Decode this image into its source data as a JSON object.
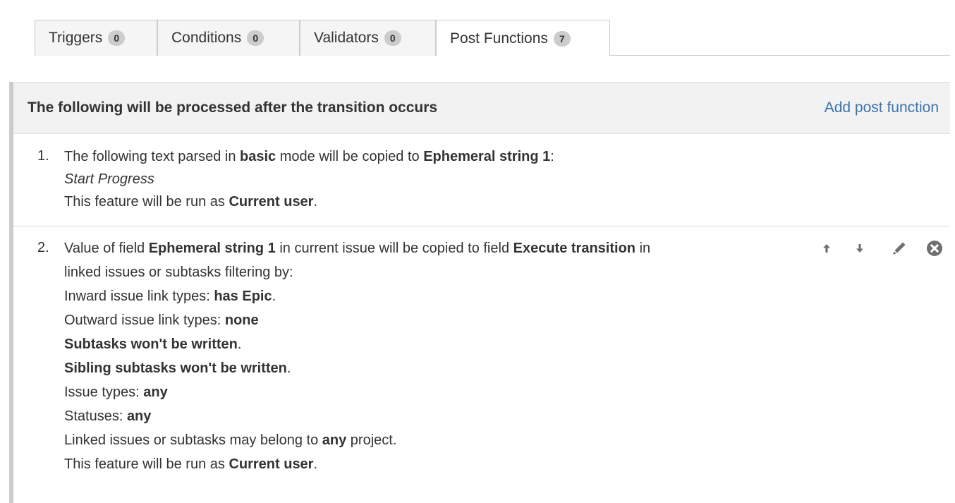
{
  "tabs": [
    {
      "label": "Triggers",
      "count": "0"
    },
    {
      "label": "Conditions",
      "count": "0"
    },
    {
      "label": "Validators",
      "count": "0"
    },
    {
      "label": "Post Functions",
      "count": "7"
    }
  ],
  "panel": {
    "title": "The following will be processed after the transition occurs",
    "add_link": "Add post function"
  },
  "items": [
    {
      "number": "1.",
      "lines": [
        {
          "segments": [
            {
              "text": "The following text parsed in ",
              "style": "normal"
            },
            {
              "text": "basic",
              "style": "bold"
            },
            {
              "text": " mode will be copied to ",
              "style": "normal"
            },
            {
              "text": "Ephemeral string 1",
              "style": "bold"
            },
            {
              "text": ":",
              "style": "normal"
            }
          ]
        },
        {
          "segments": [
            {
              "text": "Start Progress",
              "style": "italic"
            }
          ]
        },
        {
          "segments": [
            {
              "text": "This feature will be run as ",
              "style": "normal"
            },
            {
              "text": "Current user",
              "style": "bold"
            },
            {
              "text": ".",
              "style": "normal"
            }
          ]
        }
      ]
    },
    {
      "number": "2.",
      "lines": [
        {
          "segments": [
            {
              "text": "Value of field ",
              "style": "normal"
            },
            {
              "text": "Ephemeral string 1",
              "style": "bold"
            },
            {
              "text": " in current issue will be copied to field ",
              "style": "normal"
            },
            {
              "text": "Execute transition",
              "style": "bold"
            },
            {
              "text": " in",
              "style": "normal"
            }
          ]
        },
        {
          "segments": [
            {
              "text": "linked issues or subtasks filtering by:",
              "style": "normal"
            }
          ]
        },
        {
          "segments": [
            {
              "text": "Inward issue link types: ",
              "style": "normal"
            },
            {
              "text": "has Epic",
              "style": "bold"
            },
            {
              "text": ".",
              "style": "normal"
            }
          ]
        },
        {
          "segments": [
            {
              "text": "Outward issue link types: ",
              "style": "normal"
            },
            {
              "text": "none",
              "style": "bold"
            }
          ]
        },
        {
          "segments": [
            {
              "text": "Subtasks won't be written",
              "style": "bold"
            },
            {
              "text": ".",
              "style": "normal"
            }
          ]
        },
        {
          "segments": [
            {
              "text": "Sibling subtasks won't be written",
              "style": "bold"
            },
            {
              "text": ".",
              "style": "normal"
            }
          ]
        },
        {
          "segments": [
            {
              "text": "Issue types: ",
              "style": "normal"
            },
            {
              "text": "any",
              "style": "bold"
            }
          ]
        },
        {
          "segments": [
            {
              "text": "Statuses: ",
              "style": "normal"
            },
            {
              "text": "any",
              "style": "bold"
            }
          ]
        },
        {
          "segments": [
            {
              "text": "Linked issues or subtasks may belong to ",
              "style": "normal"
            },
            {
              "text": "any",
              "style": "bold"
            },
            {
              "text": " project.",
              "style": "normal"
            }
          ]
        },
        {
          "segments": [
            {
              "text": "This feature will be run as ",
              "style": "normal"
            },
            {
              "text": "Current user",
              "style": "bold"
            },
            {
              "text": ".",
              "style": "normal"
            }
          ]
        }
      ],
      "actions": [
        "move-up-icon",
        "move-down-icon",
        "edit-icon",
        "delete-icon"
      ]
    }
  ],
  "colors": {
    "link": "#3b73af",
    "header_bg": "#f2f2f2",
    "badge_bg": "#cccccc",
    "panel_border": "#cccccc",
    "icon": "#707070"
  }
}
